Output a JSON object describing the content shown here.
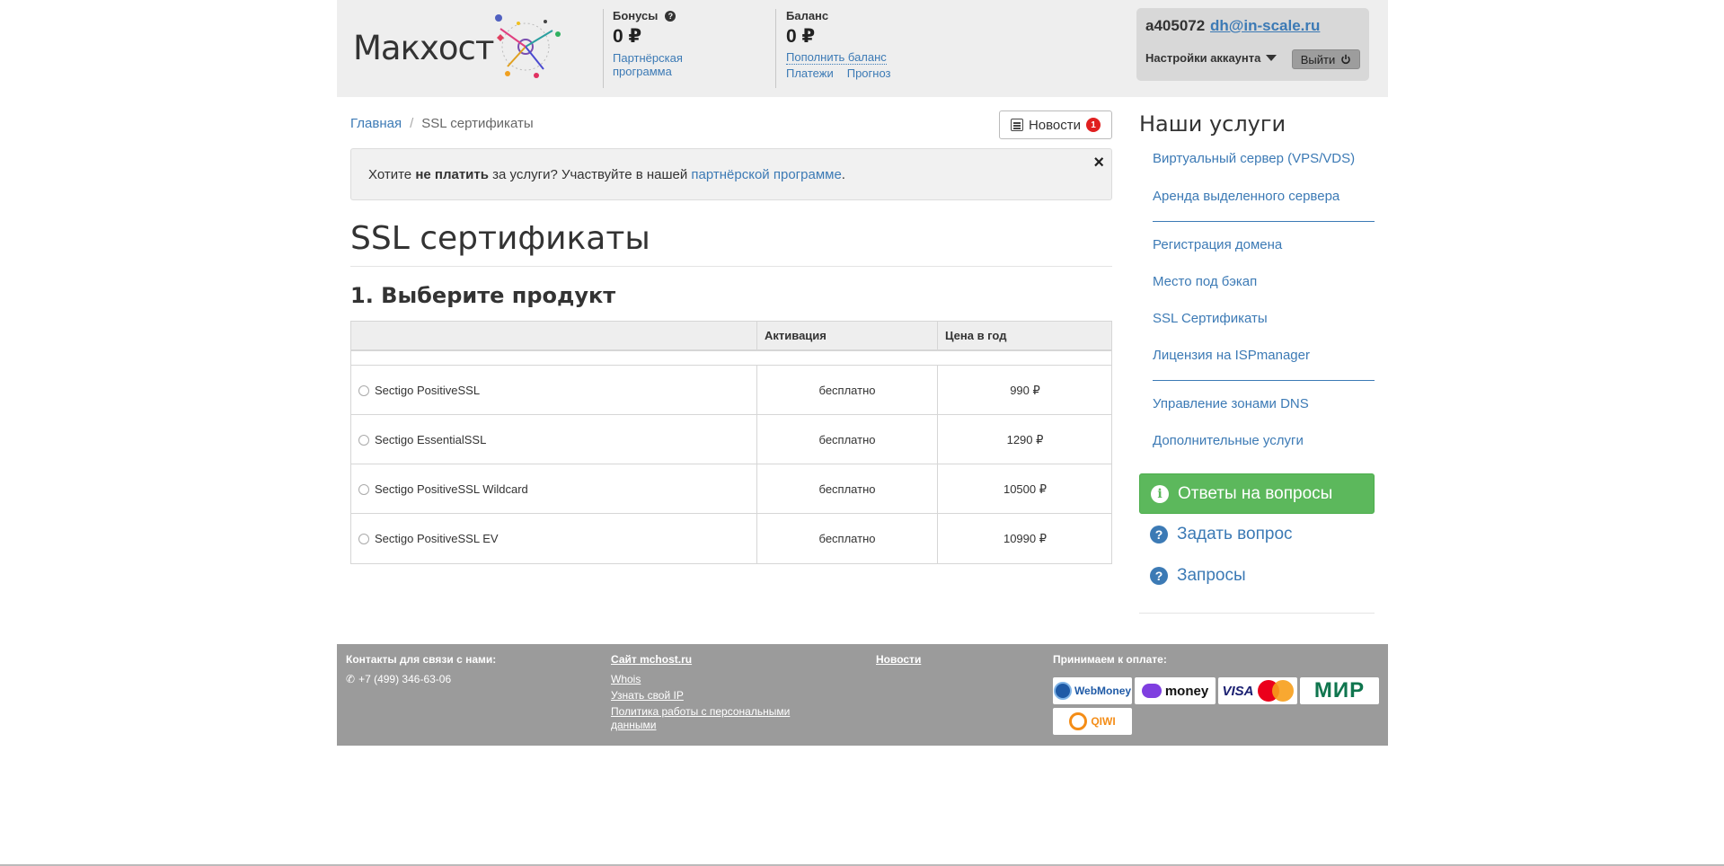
{
  "header": {
    "logo_text": "Макхост",
    "bonuses": {
      "label": "Бонусы",
      "help_icon": "question-circle-icon",
      "amount": "0 ₽",
      "link_line1": "Партнёрская",
      "link_line2": "программа"
    },
    "balance": {
      "label": "Баланс",
      "amount": "0 ₽",
      "topup_link": "Пополнить баланс",
      "payments_link": "Платежи",
      "forecast_link": "Прогноз"
    },
    "account": {
      "id": "a405072",
      "email": "dh@in-scale.ru",
      "settings_label": "Настройки аккаунта",
      "logout_label": "Выйти",
      "logout_icon": "power-icon"
    }
  },
  "breadcrumb": {
    "home": "Главная",
    "separator": "/",
    "current": "SSL сертификаты"
  },
  "news_button": {
    "label": "Новости",
    "badge": "1",
    "icon": "newspaper-icon"
  },
  "alert": {
    "text_before": "Хотите ",
    "text_bold": "не платить",
    "text_middle": " за услуги? Участвуйте в нашей ",
    "link": "партнёрской программе",
    "text_after": ".",
    "close": "×"
  },
  "page_title": "SSL сертификаты",
  "step_title": "1. Выберите продукт",
  "table": {
    "columns": [
      "",
      "Активация",
      "Цена в год"
    ],
    "rows": [
      {
        "name": "Sectigo PositiveSSL",
        "activation": "бесплатно",
        "price": "990 ₽"
      },
      {
        "name": "Sectigo EssentialSSL",
        "activation": "бесплатно",
        "price": "1290 ₽"
      },
      {
        "name": "Sectigo PositiveSSL Wildcard",
        "activation": "бесплатно",
        "price": "10500 ₽"
      },
      {
        "name": "Sectigo PositiveSSL EV",
        "activation": "бесплатно",
        "price": "10990 ₽"
      }
    ]
  },
  "sidebar": {
    "title": "Наши услуги",
    "links": [
      "Виртуальный сервер (VPS/VDS)",
      "Аренда выделенного сервера",
      "Регистрация домена",
      "Место под бэкап",
      "SSL Сертификаты",
      "Лицензия на ISPmanager",
      "Управление зонами DNS",
      "Дополнительные услуги"
    ],
    "faq_button": "Ответы на вопросы",
    "ask_question": "Задать вопрос",
    "requests": "Запросы"
  },
  "footer": {
    "contacts_title": "Контакты для связи с нами:",
    "phone": "+7 (499) 346-63-06",
    "site_link": "Сайт mchost.ru",
    "links": [
      "Whois",
      "Узнать свой IP",
      "Политика работы с персональными данными"
    ],
    "news_link": "Новости",
    "payments_title": "Принимаем к оплате:",
    "payment_logos": {
      "webmoney": "WebMoney",
      "yoomoney": "money",
      "visa": "VISA",
      "mastercard": "MasterCard",
      "mir": "МИР",
      "qiwi": "QIWI"
    }
  },
  "colors": {
    "link": "#3c7ab5",
    "success": "#5cb85c",
    "header_bg": "#eeeeee",
    "footer_bg": "#9b9b9b",
    "badge": "#e02020"
  }
}
